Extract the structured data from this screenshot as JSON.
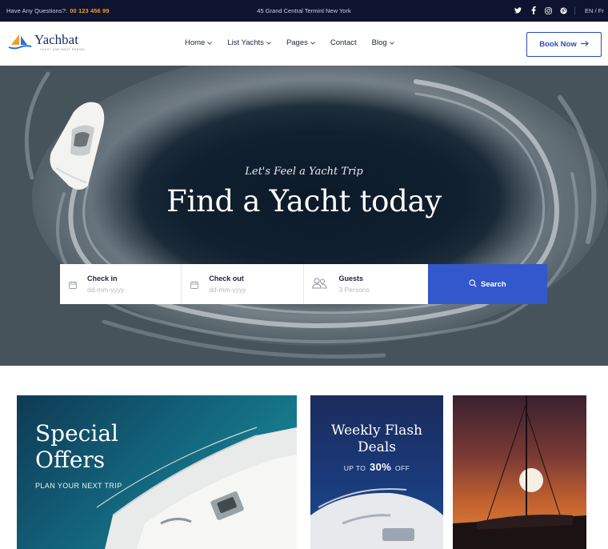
{
  "topbar": {
    "question_label": "Have Any Questions?:",
    "phone": "00 123 456 99",
    "address": "45 Grand Central Terminl New York",
    "social_icons": [
      "twitter-icon",
      "facebook-icon",
      "instagram-icon",
      "pinterest-icon"
    ],
    "language": "EN / Fr"
  },
  "nav": {
    "brand": "Yachbat",
    "tagline": "YACHT AND BOAT RENTAL",
    "menu": [
      {
        "label": "Home",
        "has_dropdown": true
      },
      {
        "label": "List Yachts",
        "has_dropdown": true
      },
      {
        "label": "Pages",
        "has_dropdown": true
      },
      {
        "label": "Contact",
        "has_dropdown": false
      },
      {
        "label": "Blog",
        "has_dropdown": true
      }
    ],
    "book_label": "Book Now"
  },
  "hero": {
    "kicker": "Let's Feel a Yacht Trip",
    "title": "Find a Yacht today",
    "search": {
      "checkin_label": "Check in",
      "checkin_placeholder": "dd-mm-yyyy",
      "checkout_label": "Check out",
      "checkout_placeholder": "dd-mm-yyyy",
      "guests_label": "Guests",
      "guests_value": "3  Persons",
      "button_label": "Search"
    }
  },
  "offers": {
    "special_title_1": "Special",
    "special_title_2": "Offers",
    "special_sub": "PLAN YOUR NEXT TRIP",
    "flash_title_1": "Weekly Flash",
    "flash_title_2": "Deals",
    "flash_prefix": "UP TO",
    "flash_percent": "30%",
    "flash_suffix": "OFF"
  },
  "colors": {
    "topbar_bg": "#0e1330",
    "phone_accent": "#f29c2c",
    "brand_blue": "#2a4bb5",
    "search_button": "#3358cc"
  }
}
